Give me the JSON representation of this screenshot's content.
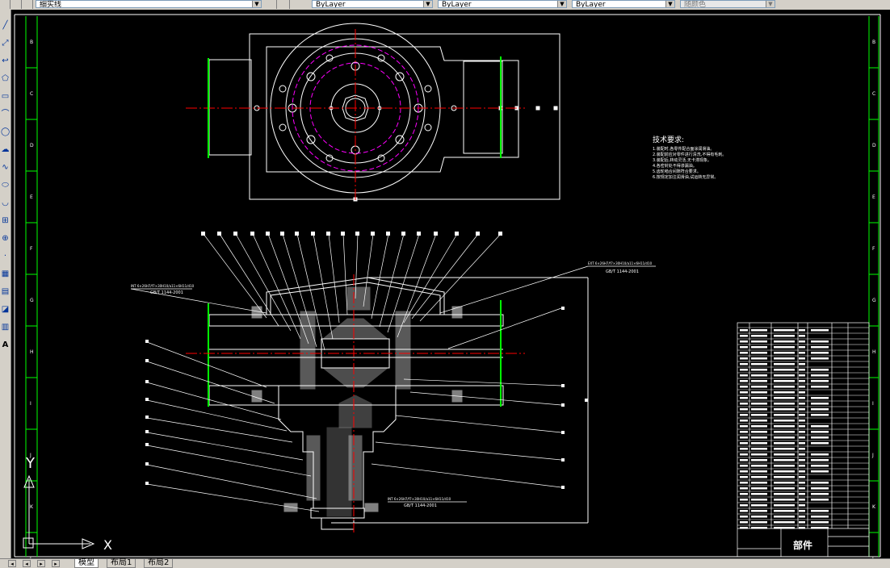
{
  "toolbar": {
    "layer_combo": "细实线",
    "color_combo": "ByLayer",
    "linetype_combo": "ByLayer",
    "lineweight_combo": "ByLayer",
    "plotstyle_combo": "随颜色"
  },
  "drawing": {
    "border_row_labels": [
      "B",
      "C",
      "D",
      "E",
      "F",
      "G",
      "H",
      "I",
      "J",
      "K",
      "L"
    ],
    "tech_req_title": "技术要求:",
    "tech_req_lines": [
      "1.装配时,各零件配合面涂润滑油。",
      "2.装配前应对零件进行清洗,不得有毛刺。",
      "3.装配后,转动灵活,无卡滞现象。",
      "4.各密封处不得渗漏油。",
      "5.齿轮啮合间隙符合要求。",
      "6.按规定加注润滑油,试运转无异常。"
    ],
    "spec_left": "GB/T 1144-2001",
    "spec_right": "GB/T 1144-2001",
    "spec_bottom": "GB/T 1144-2001",
    "title_block_name": "部件",
    "ucs_x": "X",
    "ucs_y": "Y"
  },
  "layout_tabs": [
    "模型",
    "布局1",
    "布局2"
  ],
  "colors": {
    "background": "#000000",
    "line": "#ffffff",
    "centerline": "#ff0000",
    "hidden": "#ff00ff",
    "border": "#00ff00"
  }
}
